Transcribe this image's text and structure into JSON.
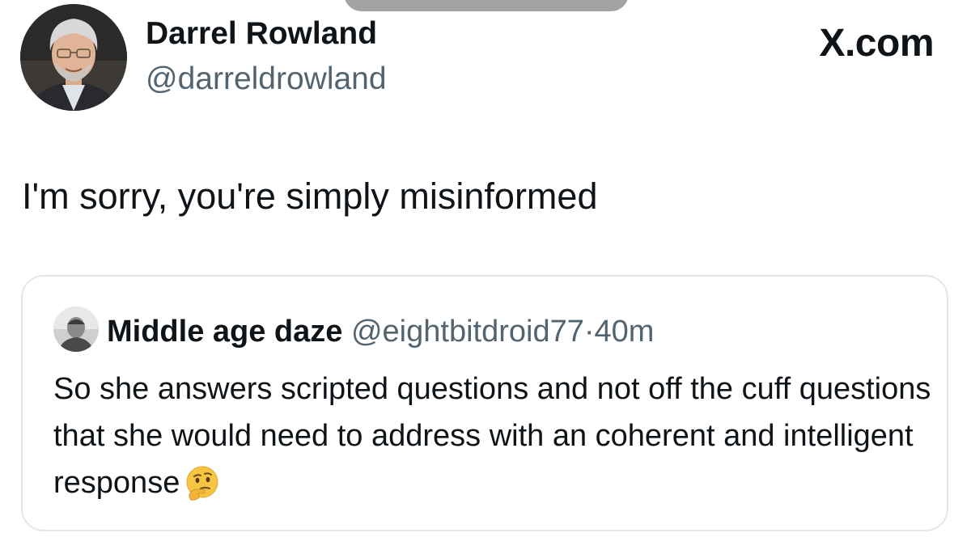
{
  "tweet": {
    "author_name": "Darrel Rowland",
    "author_handle": "@darreldrowland",
    "text": "I'm sorry, you're simply misinformed"
  },
  "brand": {
    "label": "X.com"
  },
  "quoted_tweet": {
    "author_name": "Middle age daze",
    "author_handle": "@eightbitdroid77",
    "separator": "·",
    "time": "40m",
    "text": "So she answers scripted questions and not off the cuff questions that she would need to address with an coherent and intelligent response",
    "emoji_icon": "thinking-face-icon"
  },
  "colors": {
    "primary_text": "#0f1419",
    "secondary_text": "#536471",
    "card_border": "#e1e8ed"
  }
}
